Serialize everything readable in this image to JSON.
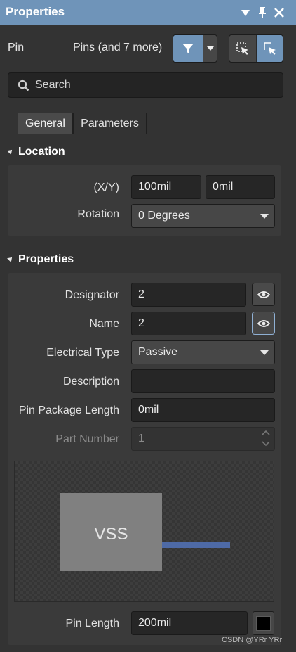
{
  "titlebar": {
    "title": "Properties",
    "icons": [
      "dropdown-icon",
      "pin-icon",
      "close-icon"
    ]
  },
  "header": {
    "object_type": "Pin",
    "selection_summary": "Pins (and 7 more)",
    "icons": [
      "filter-icon",
      "dropdown-arrow-icon",
      "select-window-icon",
      "select-pointer-icon"
    ]
  },
  "search": {
    "placeholder": "Search",
    "icon": "search-icon"
  },
  "tabs": [
    {
      "label": "General",
      "active": true
    },
    {
      "label": "Parameters",
      "active": false
    }
  ],
  "location": {
    "heading": "Location",
    "xy_label": "(X/Y)",
    "x_value": "100mil",
    "y_value": "0mil",
    "rotation_label": "Rotation",
    "rotation_value": "0 Degrees"
  },
  "properties": {
    "heading": "Properties",
    "designator_label": "Designator",
    "designator_value": "2",
    "name_label": "Name",
    "name_value": "2",
    "electrical_type_label": "Electrical Type",
    "electrical_type_value": "Passive",
    "description_label": "Description",
    "description_value": "",
    "pin_package_length_label": "Pin Package Length",
    "pin_package_length_value": "0mil",
    "part_number_label": "Part Number",
    "part_number_value": "1",
    "preview_text": "VSS",
    "pin_length_label": "Pin Length",
    "pin_length_value": "200mil"
  },
  "colors": {
    "title_bar": "#6f94b9",
    "panel_bg": "#333333",
    "accent": "#6f94b9",
    "pin_line": "#4e6aa6",
    "pin_color": "#000000"
  },
  "watermark": "CSDN @YRr YRr"
}
